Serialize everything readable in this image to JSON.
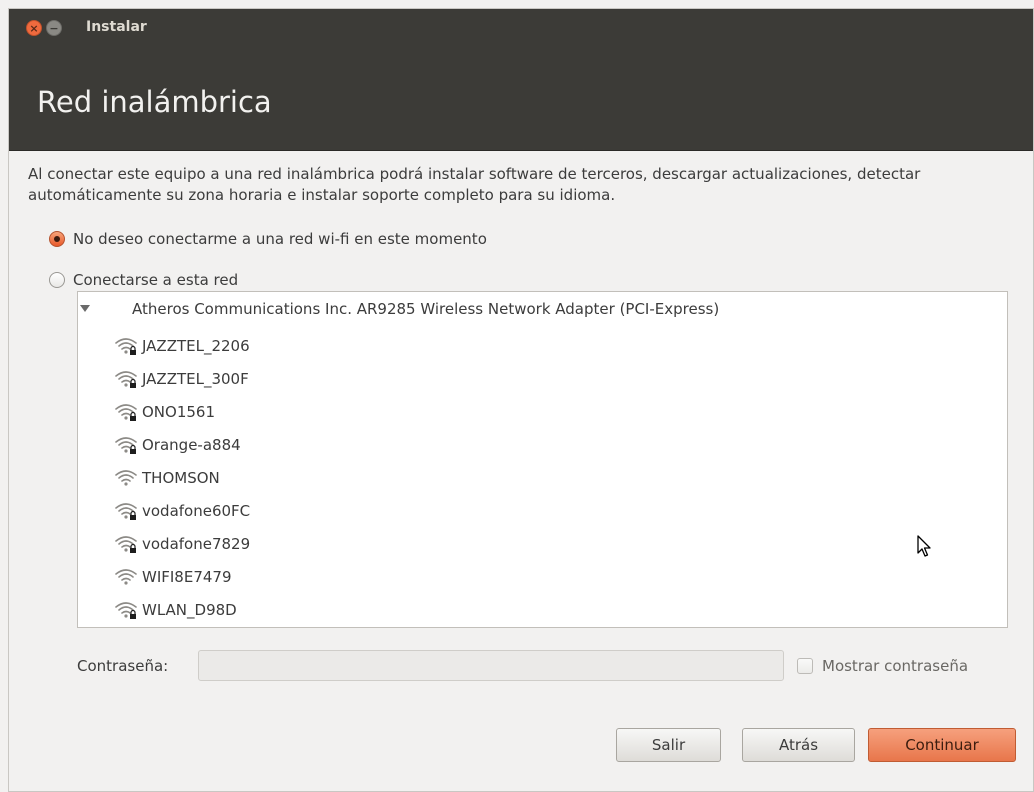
{
  "window": {
    "title": "Instalar",
    "close_glyph": "×",
    "minimize_glyph": "−"
  },
  "header": {
    "title": "Red inalámbrica"
  },
  "description": "Al conectar este equipo a una red inalámbrica podrá instalar software de terceros, descargar actualizaciones, detectar automáticamente su zona horaria e instalar soporte completo para su idioma.",
  "options": [
    {
      "label": "No deseo conectarme a una red wi-fi en este momento",
      "selected": true
    },
    {
      "label": "Conectarse a esta red",
      "selected": false
    }
  ],
  "network_list": {
    "adapter": "Atheros Communications Inc. AR9285 Wireless Network Adapter (PCI-Express)",
    "networks": [
      {
        "ssid": "JAZZTEL_2206",
        "secured": true,
        "icon": "wifi-secure-icon"
      },
      {
        "ssid": "JAZZTEL_300F",
        "secured": true,
        "icon": "wifi-secure-icon"
      },
      {
        "ssid": "ONO1561",
        "secured": true,
        "icon": "wifi-secure-icon"
      },
      {
        "ssid": "Orange-a884",
        "secured": true,
        "icon": "wifi-secure-icon"
      },
      {
        "ssid": "THOMSON",
        "secured": false,
        "icon": "wifi-icon"
      },
      {
        "ssid": "vodafone60FC",
        "secured": true,
        "icon": "wifi-secure-icon"
      },
      {
        "ssid": "vodafone7829",
        "secured": true,
        "icon": "wifi-secure-icon"
      },
      {
        "ssid": "WIFI8E7479",
        "secured": false,
        "icon": "wifi-icon"
      },
      {
        "ssid": "WLAN_D98D",
        "secured": true,
        "icon": "wifi-secure-icon"
      }
    ]
  },
  "password": {
    "label": "Contraseña:",
    "value": "",
    "show_label": "Mostrar contraseña",
    "show_checked": false
  },
  "buttons": {
    "quit": "Salir",
    "back": "Atrás",
    "continue": "Continuar"
  },
  "colors": {
    "accent": "#e8764b",
    "header_bg": "#3c3b37"
  }
}
